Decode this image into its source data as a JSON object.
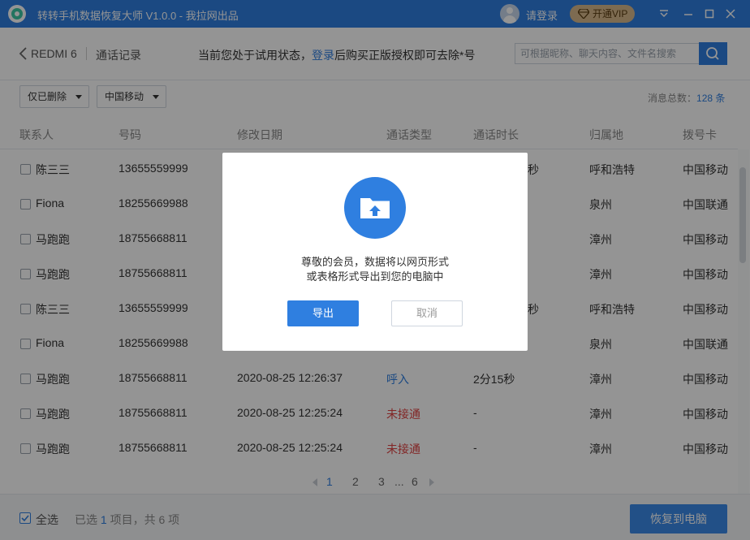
{
  "titlebar": {
    "app_title": "转转手机数据恢复大师 V1.0.0 - 我拉网出品",
    "login_label": "请登录",
    "vip_label": "开通VIP",
    "brand_color": "#2f7fe0",
    "vip_color": "#d8b98c"
  },
  "header": {
    "device_name": "REDMI 6",
    "section": "通话记录",
    "notice_before": "当前您处于试用状态，",
    "notice_link": "登录",
    "notice_after": "后购买正版授权即可去除*号",
    "search_placeholder": "可根据昵称、聊天内容、文件名搜索"
  },
  "filters": {
    "deleted_filter": "仅已删除",
    "carrier_filter": "中国移动"
  },
  "summary": {
    "label": "消息总数：",
    "count": "128 条"
  },
  "table": {
    "columns": [
      "联系人",
      "号码",
      "修改日期",
      "通话类型",
      "通话时长",
      "归属地",
      "拨号卡"
    ],
    "rows": [
      {
        "contact": "陈三三",
        "number": "13655559999",
        "date": "",
        "type": "",
        "duration": "秒",
        "location": "呼和浩特",
        "card": "中国移动"
      },
      {
        "contact": "Fiona",
        "number": "18255669988",
        "date": "",
        "type": "",
        "duration": "",
        "location": "泉州",
        "card": "中国联通"
      },
      {
        "contact": "马跑跑",
        "number": "18755668811",
        "date": "",
        "type": "",
        "duration": "",
        "location": "漳州",
        "card": "中国移动"
      },
      {
        "contact": "马跑跑",
        "number": "18755668811",
        "date": "",
        "type": "",
        "duration": "",
        "location": "漳州",
        "card": "中国移动"
      },
      {
        "contact": "陈三三",
        "number": "13655559999",
        "date": "",
        "type": "",
        "duration": "秒",
        "location": "呼和浩特",
        "card": "中国移动"
      },
      {
        "contact": "Fiona",
        "number": "18255669988",
        "date": "",
        "type": "",
        "duration": "",
        "location": "泉州",
        "card": "中国联通"
      },
      {
        "contact": "马跑跑",
        "number": "18755668811",
        "date": "2020-08-25 12:26:37",
        "type": "呼入",
        "duration": "2分15秒",
        "location": "漳州",
        "card": "中国移动"
      },
      {
        "contact": "马跑跑",
        "number": "18755668811",
        "date": "2020-08-25 12:25:24",
        "type": "未接通",
        "duration": "-",
        "location": "漳州",
        "card": "中国移动"
      },
      {
        "contact": "马跑跑",
        "number": "18755668811",
        "date": "2020-08-25 12:25:24",
        "type": "未接通",
        "duration": "-",
        "location": "漳州",
        "card": "中国移动"
      }
    ]
  },
  "pagination": {
    "pages": [
      "1",
      "2",
      "3"
    ],
    "ellipsis": "...",
    "last": "6",
    "current": "1"
  },
  "footer": {
    "select_all": "全选",
    "selected_prefix": "已选 ",
    "selected_count": "1",
    "selected_suffix": " 项目，共 6 项",
    "recover_label": "恢复到电脑"
  },
  "modal": {
    "line1": "尊敬的会员，数据将以网页形式",
    "line2": "或表格形式导出到您的电脑中",
    "export_label": "导出",
    "cancel_label": "取消",
    "icon": "folder-upload-icon"
  }
}
